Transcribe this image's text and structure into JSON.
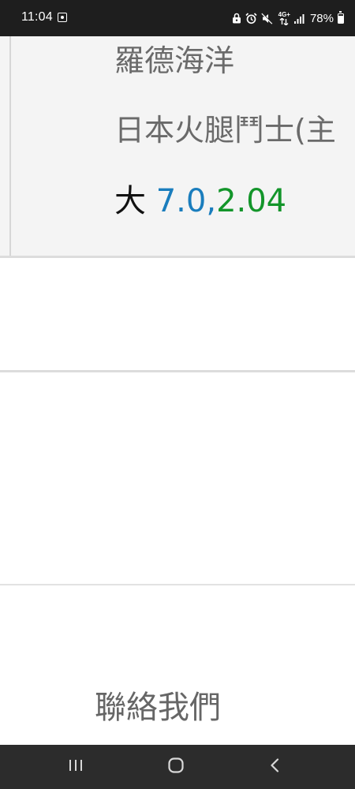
{
  "status_bar": {
    "time": "11:04",
    "network": "4G+",
    "battery_percent": "78%",
    "icons": [
      "notification-icon",
      "lock-icon",
      "alarm-icon",
      "mute-icon",
      "network-icon",
      "signal-icon",
      "battery-icon"
    ]
  },
  "card": {
    "name": "羅德海洋",
    "type": "日本火腿鬥士(主",
    "size_label": "大",
    "stat_a": "7.0",
    "separator": ",",
    "stat_b": "2.04",
    "colors": {
      "stat_a": "#1a7dbd",
      "stat_b": "#13952a"
    }
  },
  "footer": {
    "contact_label": "聯絡我們"
  },
  "nav_bar": {
    "icons": [
      "recents-icon",
      "home-icon",
      "back-icon"
    ]
  }
}
